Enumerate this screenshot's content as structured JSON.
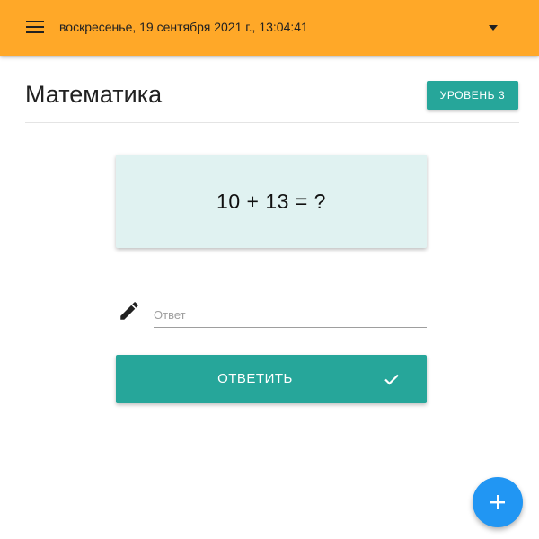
{
  "header": {
    "datetime": "воскресенье, 19 сентября 2021 г., 13:04:41",
    "menu_icon": "hamburger-menu-icon",
    "dropdown_icon": "caret-down-icon",
    "background_color": "#FFA828"
  },
  "main": {
    "title": "Математика",
    "level_button_label": "УРОВЕНЬ 3",
    "question": "10 + 13 = ?",
    "answer": {
      "value": "",
      "placeholder": "Ответ",
      "icon": "pencil-icon"
    },
    "submit_label": "ОТВЕТИТЬ",
    "submit_icon": "check-icon"
  },
  "fab": {
    "icon": "plus-icon",
    "color": "#2196F3"
  },
  "colors": {
    "accent": "#26A69A",
    "card_background": "#E0F2F1"
  }
}
